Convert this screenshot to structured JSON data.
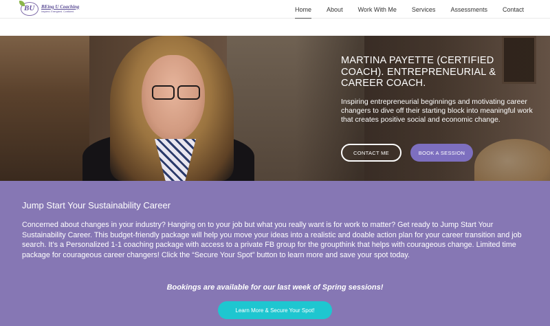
{
  "logo": {
    "monogram": "BU",
    "name": "BEing U Coaching",
    "tagline": "Inspired. Energized. Confident."
  },
  "nav": {
    "items": [
      "Home",
      "About",
      "Work With Me",
      "Services",
      "Assessments",
      "Contact"
    ],
    "active": "Home"
  },
  "hero": {
    "title": "MARTINA PAYETTE (CERTIFIED COACH). ENTREPRENEURIAL & CAREER COACH.",
    "description": "Inspiring entrepreneurial beginnings and motivating career changers to dive off their starting block into meaningful work that creates positive social and economic change.",
    "contact_button": "CONTACT ME",
    "book_button": "BOOK A SESSION"
  },
  "promo": {
    "heading": "Jump Start Your Sustainability Career",
    "body": "Concerned about changes in your industry?  Hanging on to your job but what you really want is for work to matter?  Get ready to Jump Start Your Sustainability Career.  This budget-friendly package will help you move your ideas into a realistic and doable action plan for your career transition and job search.  It’s a Personalized 1-1 coaching package with access to a private FB group for the groupthink that helps with courageous change. Limited time package for courageous career changers!  Click the “Secure Your Spot” button to learn more and save your spot today.",
    "note": "Bookings are available for our last week of Spring sessions!",
    "cta": "Learn More & Secure Your Spot!"
  },
  "colors": {
    "accent": "#8677b4",
    "button_purple": "#7d6fbf",
    "button_teal": "#1ec6d0"
  }
}
